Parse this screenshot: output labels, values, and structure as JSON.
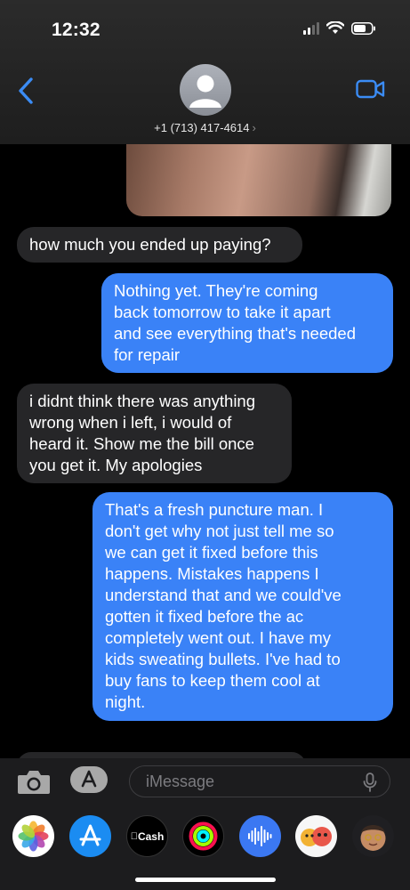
{
  "status_bar": {
    "time": "12:32"
  },
  "conversation": {
    "contact_number": "+1 (713) 417-4614",
    "chevron": "›"
  },
  "messages": [
    {
      "direction": "incoming",
      "text": "how much you ended up paying?"
    },
    {
      "direction": "outgoing",
      "text": "Nothing yet. They're coming\nback tomorrow to take it apart\nand see everything that's needed\nfor repair"
    },
    {
      "direction": "incoming",
      "text": "i didnt think there was anything\nwrong when i left, i would of\nheard it. Show me the bill once\nyou get it. My apologies"
    },
    {
      "direction": "outgoing",
      "text": "That's a fresh puncture man. I\ndon't get why not just tell me so\nwe can get it fixed before this\nhappens. Mistakes happens I\nunderstand that and we could've\ngotten it fixed before the ac\ncompletely went out. I have my\nkids sweating bullets. I've had to\nbuy fans to keep them cool at\nnight."
    }
  ],
  "compose": {
    "placeholder": "iMessage"
  },
  "app_tray": {
    "apps": [
      {
        "name": "photos",
        "icon": "photos-icon"
      },
      {
        "name": "app-store",
        "icon": "app-store-icon"
      },
      {
        "name": "cash",
        "label": "Cash",
        "icon": "cash-icon"
      },
      {
        "name": "activity",
        "icon": "activity-rings-icon"
      },
      {
        "name": "audio",
        "icon": "waveform-icon"
      },
      {
        "name": "memoji-stickers",
        "icon": "memoji-icon"
      },
      {
        "name": "memoji",
        "icon": "memoji-icon"
      }
    ]
  },
  "colors": {
    "outgoing_bubble": "#3a82f7",
    "incoming_bubble": "#262628",
    "accent": "#3b8cf5"
  }
}
